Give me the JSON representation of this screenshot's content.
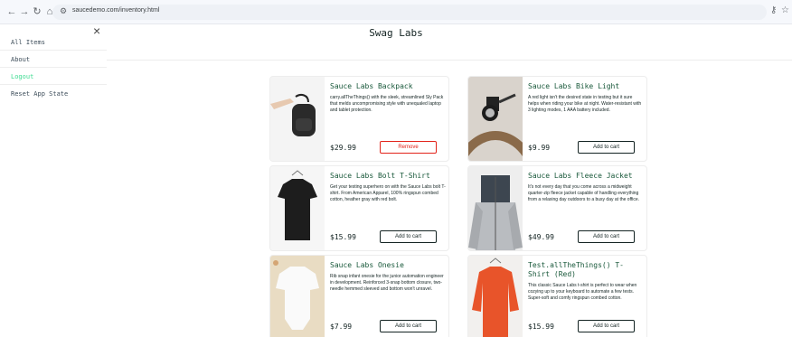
{
  "browser": {
    "url": "saucedemo.com/inventory.html",
    "back_icon": "arrow-left-icon",
    "forward_icon": "arrow-right-icon",
    "reload_icon": "reload-icon",
    "home_icon": "home-icon",
    "site_info_icon": "site-info-icon"
  },
  "menu": {
    "close_glyph": "×",
    "items": [
      {
        "label": "All Items"
      },
      {
        "label": "About"
      },
      {
        "label": "Logout"
      },
      {
        "label": "Reset App State"
      }
    ]
  },
  "header": {
    "title": "Swag Labs"
  },
  "products": [
    {
      "title": "Sauce Labs Backpack",
      "description": "carry.allTheThings() with the sleek, streamlined Sly Pack that melds uncompromising style with unequaled laptop and tablet protection.",
      "price": "$29.99",
      "button": "Remove"
    },
    {
      "title": "Sauce Labs Bike Light",
      "description": "A red light isn't the desired state in testing but it sure helps when riding your bike at night. Water-resistant with 3 lighting modes, 1 AAA battery included.",
      "price": "$9.99",
      "button": "Add to cart"
    },
    {
      "title": "Sauce Labs Bolt T-Shirt",
      "description": "Get your testing superhero on with the Sauce Labs bolt T-shirt. From American Apparel, 100% ringspun combed cotton, heather gray with red bolt.",
      "price": "$15.99",
      "button": "Add to cart"
    },
    {
      "title": "Sauce Labs Fleece Jacket",
      "description": "It's not every day that you come across a midweight quarter-zip fleece jacket capable of handling everything from a relaxing day outdoors to a busy day at the office.",
      "price": "$49.99",
      "button": "Add to cart"
    },
    {
      "title": "Sauce Labs Onesie",
      "description": "Rib snap infant onesie for the junior automation engineer in development. Reinforced 3-snap bottom closure, two-needle hemmed sleeved and bottom won't unravel.",
      "price": "$7.99",
      "button": "Add to cart"
    },
    {
      "title": "Test.allTheThings() T-Shirt (Red)",
      "description": "This classic Sauce Labs t-shirt is perfect to wear when cozying up to your keyboard to automate a few tests. Super-soft and comfy ringspun combed cotton.",
      "price": "$15.99",
      "button": "Add to cart"
    }
  ]
}
